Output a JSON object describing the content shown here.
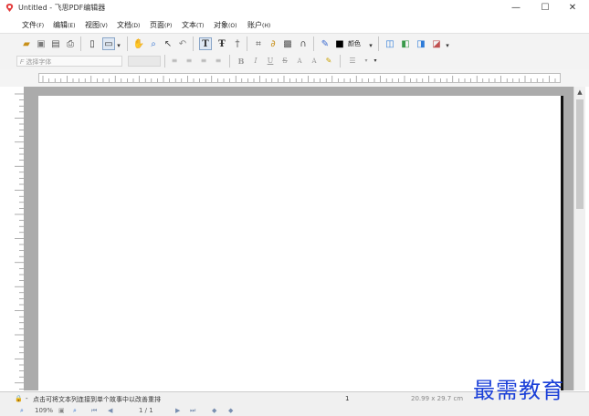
{
  "window": {
    "title": "Untitled - 飞思PDF编辑器",
    "minimize": "—",
    "maximize": "☐",
    "close": "✕"
  },
  "menu": [
    {
      "label": "文件",
      "accel": "(F)"
    },
    {
      "label": "编辑",
      "accel": "(E)"
    },
    {
      "label": "视图",
      "accel": "(V)"
    },
    {
      "label": "文档",
      "accel": "(D)"
    },
    {
      "label": "页面",
      "accel": "(P)"
    },
    {
      "label": "文本",
      "accel": "(T)"
    },
    {
      "label": "对象",
      "accel": "(O)"
    },
    {
      "label": "账户",
      "accel": "(H)"
    }
  ],
  "toolbar": {
    "color_label": "颜色",
    "icons": [
      "open-icon",
      "save-icon",
      "properties-icon",
      "print-icon",
      "page-icon",
      "page-view-icon",
      "hand-icon",
      "zoom-icon",
      "select-icon",
      "undo-icon",
      "text-icon",
      "text-edit-icon",
      "text-insert-icon",
      "crop-icon",
      "link-icon",
      "image-icon",
      "curve-icon",
      "eyedropper-icon",
      "color-swatch-icon",
      "insert-page-icon",
      "extract-page-icon",
      "replace-page-icon",
      "delete-page-icon"
    ]
  },
  "format_bar": {
    "font_placeholder": "选择字体",
    "bold": "B",
    "italic": "I",
    "underline": "U",
    "strike": "S",
    "superscript": "A",
    "subscript": "A"
  },
  "status": {
    "hint": "点击可将文本列连接到单个故事中以改善重排",
    "page_field": "1",
    "page_size": "20.99 x 29.7 cm"
  },
  "nav": {
    "zoom": "109%",
    "page_indicator": "1 / 1"
  },
  "watermark": "最需教育",
  "colors": {
    "watermark": "#1a3fd8",
    "canvas": "#ababab",
    "toolbar": "#f3f3f3"
  }
}
